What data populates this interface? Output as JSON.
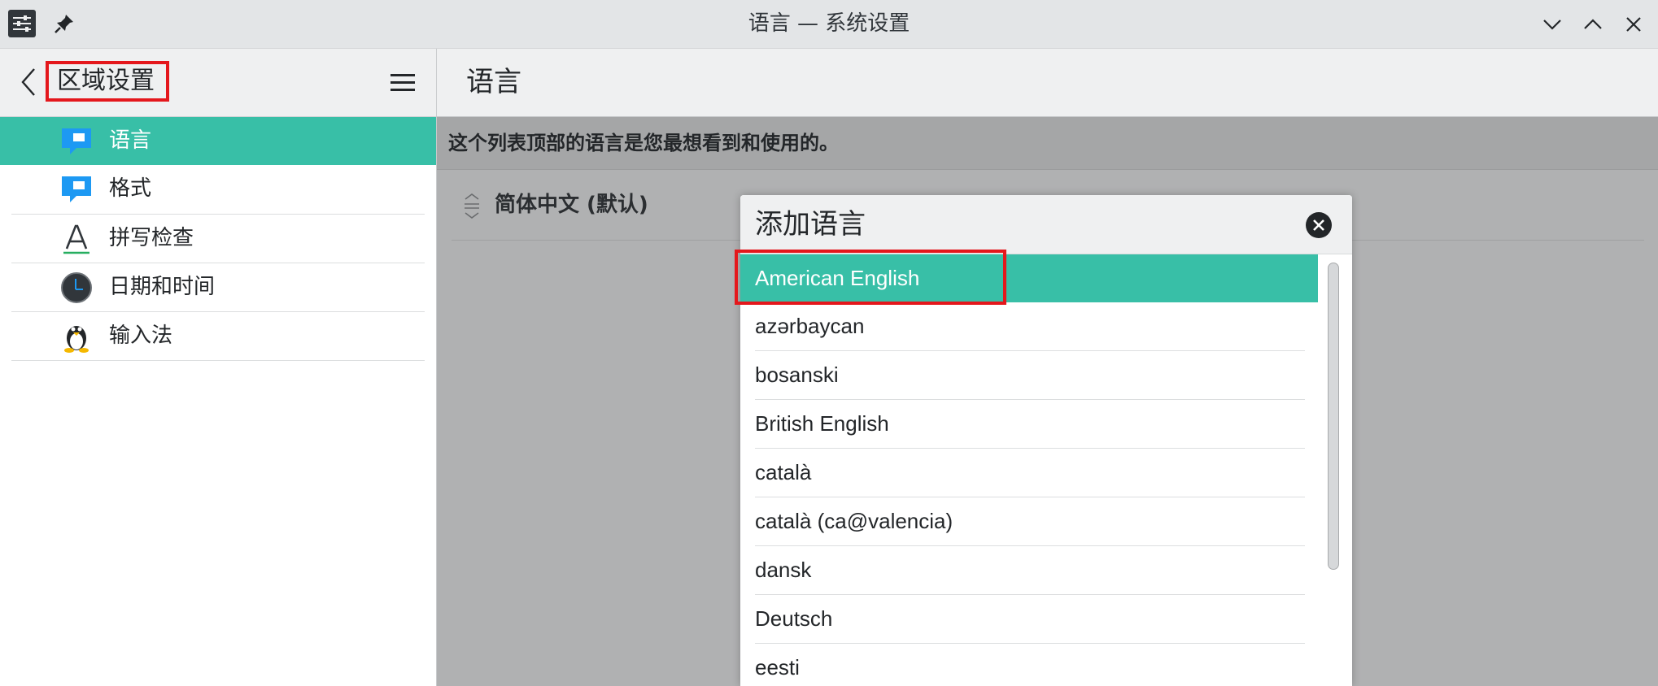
{
  "window": {
    "title": "语言 — 系统设置"
  },
  "sidebar": {
    "title": "区域设置",
    "items": [
      {
        "label": "语言",
        "icon": "speech-bubble-icon",
        "selected": true
      },
      {
        "label": "格式",
        "icon": "speech-bubble-icon",
        "selected": false
      },
      {
        "label": "拼写检查",
        "icon": "letter-a-icon",
        "selected": false
      },
      {
        "label": "日期和时间",
        "icon": "clock-icon",
        "selected": false
      },
      {
        "label": "输入法",
        "icon": "penguin-icon",
        "selected": false
      }
    ]
  },
  "main": {
    "title": "语言",
    "info": "这个列表顶部的语言是您最想看到和使用的。",
    "languages": [
      {
        "label": "简体中文 (默认)"
      }
    ]
  },
  "dialog": {
    "title": "添加语言",
    "languages": [
      "American English",
      "azərbaycan",
      "bosanski",
      "British English",
      "català",
      "català (ca@valencia)",
      "dansk",
      "Deutsch",
      "eesti"
    ],
    "selected_index": 0
  },
  "colors": {
    "accent": "#38bfa7",
    "highlight_box": "#e4171c",
    "overlay": "#b0b1b2"
  }
}
